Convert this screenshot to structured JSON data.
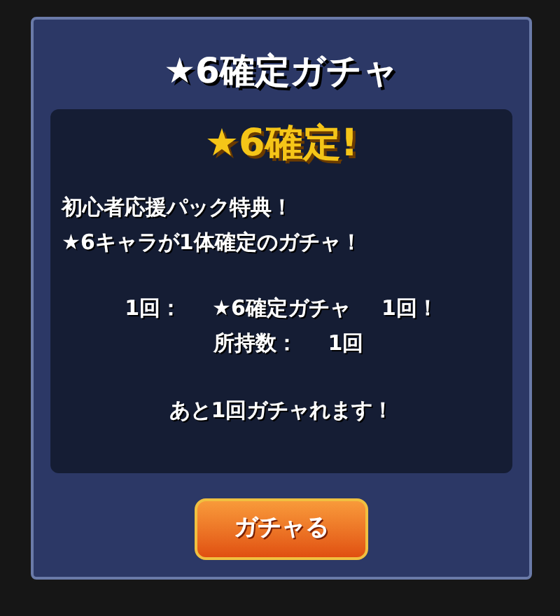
{
  "dialog": {
    "title": "★6確定ガチャ",
    "headline": "★6確定!",
    "description": [
      "初心者応援パック特典！",
      "★6キャラが1体確定のガチャ！"
    ],
    "details": [
      {
        "cells": [
          "1回：",
          "★6確定ガチャ",
          "1回！"
        ]
      },
      {
        "cells": [
          "所持数：",
          "1回"
        ]
      }
    ],
    "remaining": "あと**1回**ガチャれます！",
    "button": "ガチャる"
  }
}
